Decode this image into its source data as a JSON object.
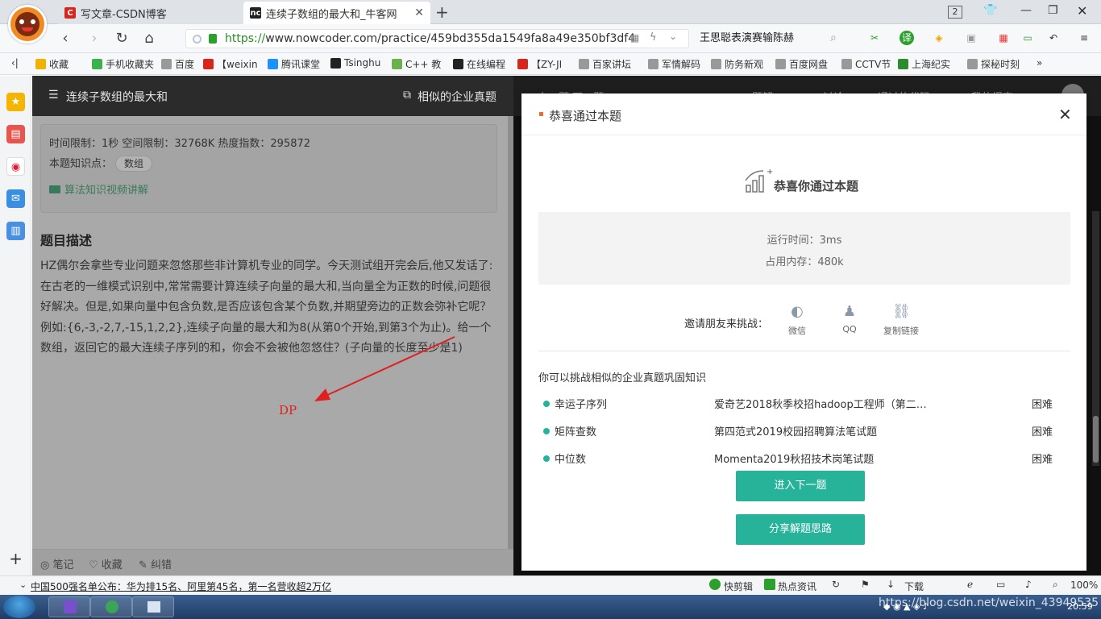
{
  "browser": {
    "tabs": [
      {
        "title": "写文章-CSDN博客",
        "icon_text": "C",
        "icon_color": "#d9261c",
        "active": false
      },
      {
        "title": "连续子数组的最大和_牛客网",
        "icon_text": "nc",
        "icon_color": "#222222",
        "active": true
      }
    ],
    "new_tab": "+",
    "tab_count": "2",
    "url_scheme": "https://",
    "url_rest": "www.nowcoder.com/practice/459bd355da1549fa8a49e350bf3df4",
    "search_text": "王思聪表演赛输陈赫",
    "bookmarks": [
      {
        "label": "收藏",
        "icon": "star-icon",
        "color": "#f0b400"
      },
      {
        "label": "手机收藏夹",
        "icon": "phone-icon",
        "color": "#3bb34a"
      },
      {
        "label": "百度",
        "icon": "page-icon",
        "color": "#999999"
      },
      {
        "label": "【weixin",
        "icon": "csdn-icon",
        "color": "#d9261c"
      },
      {
        "label": "腾讯课堂",
        "icon": "tencent-icon",
        "color": "#1e90ff"
      },
      {
        "label": "Tsinghu",
        "icon": "github-icon",
        "color": "#222222"
      },
      {
        "label": "C++ 教",
        "icon": "runoob-icon",
        "color": "#6ab04c"
      },
      {
        "label": "在线编程",
        "icon": "nowcoder-icon",
        "color": "#222222"
      },
      {
        "label": "【ZY-JI",
        "icon": "csdn-icon",
        "color": "#d9261c"
      },
      {
        "label": "百家讲坛",
        "icon": "page-icon",
        "color": "#999999"
      },
      {
        "label": "军情解码",
        "icon": "page-icon",
        "color": "#999999"
      },
      {
        "label": "防务新观",
        "icon": "page-icon",
        "color": "#999999"
      },
      {
        "label": "百度网盘",
        "icon": "page-icon",
        "color": "#999999"
      },
      {
        "label": "CCTV节",
        "icon": "page-icon",
        "color": "#999999"
      },
      {
        "label": "上海纪实",
        "icon": "tv-icon",
        "color": "#2e8b2e"
      },
      {
        "label": "探秘时刻",
        "icon": "page-icon",
        "color": "#999999"
      }
    ],
    "bookmarks_more": "»"
  },
  "problem": {
    "title": "连续子数组的最大和",
    "similar_label": "相似的企业真题",
    "prev_next": "上一题    下一题",
    "right_tabs": [
      "题解",
      "讨论",
      "通过的代码",
      "我的提交"
    ],
    "info_line": "时间限制：1秒    空间限制：32768K    热度指数：295872",
    "knowledge_label": "本题知识点：",
    "knowledge_tag": "数组",
    "video_link": "算法知识视频讲解",
    "desc_title": "题目描述",
    "description": "HZ偶尔会拿些专业问题来忽悠那些非计算机专业的同学。今天测试组开完会后,他又发话了:在古老的一维模式识别中,常常需要计算连续子向量的最大和,当向量全为正数的时候,问题很好解决。但是,如果向量中包含负数,是否应该包含某个负数,并期望旁边的正数会弥补它呢？例如:{6,-3,-2,7,-15,1,2,2},连续子向量的最大和为8(从第0个开始,到第3个为止)。给一个数组，返回它的最大连续子序列的和，你会不会被他忽悠住？(子向量的长度至少是1)",
    "annotation": "DP",
    "bottom_actions": [
      "笔记",
      "收藏",
      "纠错"
    ]
  },
  "modal": {
    "header": "恭喜通过本题",
    "success_title": "恭喜你通过本题",
    "run_time": "运行时间：3ms",
    "memory": "占用内存：480k",
    "invite_label": "邀请朋友来挑战：",
    "share": [
      {
        "label": "微信",
        "icon": "wechat-icon"
      },
      {
        "label": "QQ",
        "icon": "qq-icon"
      },
      {
        "label": "复制链接",
        "icon": "link-icon"
      }
    ],
    "related_title": "你可以挑战相似的企业真题巩固知识",
    "related": [
      {
        "name": "幸运子序列",
        "source": "爱奇艺2018秋季校招hadoop工程师（第二…",
        "difficulty": "困难"
      },
      {
        "name": "矩阵查数",
        "source": "第四范式2019校园招聘算法笔试题",
        "difficulty": "困难"
      },
      {
        "name": "中位数",
        "source": "Momenta2019秋招技术岗笔试题",
        "difficulty": "困难"
      }
    ],
    "next_button": "进入下一题",
    "share_button": "分享解题思路",
    "accent": "#27b39a"
  },
  "statusbar": {
    "news": "中国500强名单公布：华为排15名、阿里第45名，第一名营收超2万亿",
    "items": [
      "快剪辑",
      "热点资讯",
      "下载"
    ],
    "zoom": "100%"
  },
  "taskbar": {
    "time": "20:59",
    "watermark": "https://blog.csdn.net/weixin_43949535"
  }
}
